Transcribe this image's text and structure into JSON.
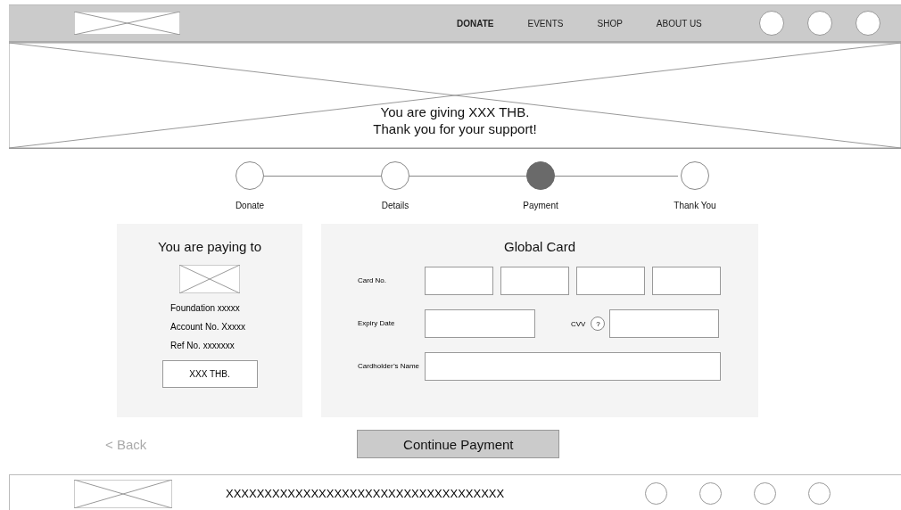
{
  "header": {
    "nav": [
      {
        "label": "DONATE",
        "selected": true
      },
      {
        "label": "EVENTS",
        "selected": false
      },
      {
        "label": "SHOP",
        "selected": false
      },
      {
        "label": "ABOUT US",
        "selected": false
      }
    ]
  },
  "hero": {
    "lines": [
      "You are giving XXX THB.",
      "Thank you for your support!"
    ]
  },
  "steps": [
    {
      "label": "Donate",
      "selected": false
    },
    {
      "label": "Details",
      "selected": false
    },
    {
      "label": "Payment",
      "selected": true
    },
    {
      "label": "Thank You",
      "selected": false
    }
  ],
  "payee": {
    "title": "You are paying to",
    "details": [
      "Foundation xxxxx",
      "Account No. Xxxxx",
      "Ref No. xxxxxxx"
    ],
    "amount": "XXX THB."
  },
  "card_form": {
    "title": "Global Card",
    "fields": [
      {
        "kind": "card_number",
        "label": "Card No."
      },
      {
        "kind": "expiry_cvv",
        "label": "Expiry Date",
        "second_label": "CVV",
        "help": "?"
      },
      {
        "kind": "text",
        "label": "Cardholder’s Name"
      }
    ]
  },
  "actions": {
    "back": "< Back",
    "continue": "Continue Payment"
  },
  "footer": {
    "text": "XXXXXXXXXXXXXXXXXXXXXXXXXXXXXXXXXXXX"
  }
}
